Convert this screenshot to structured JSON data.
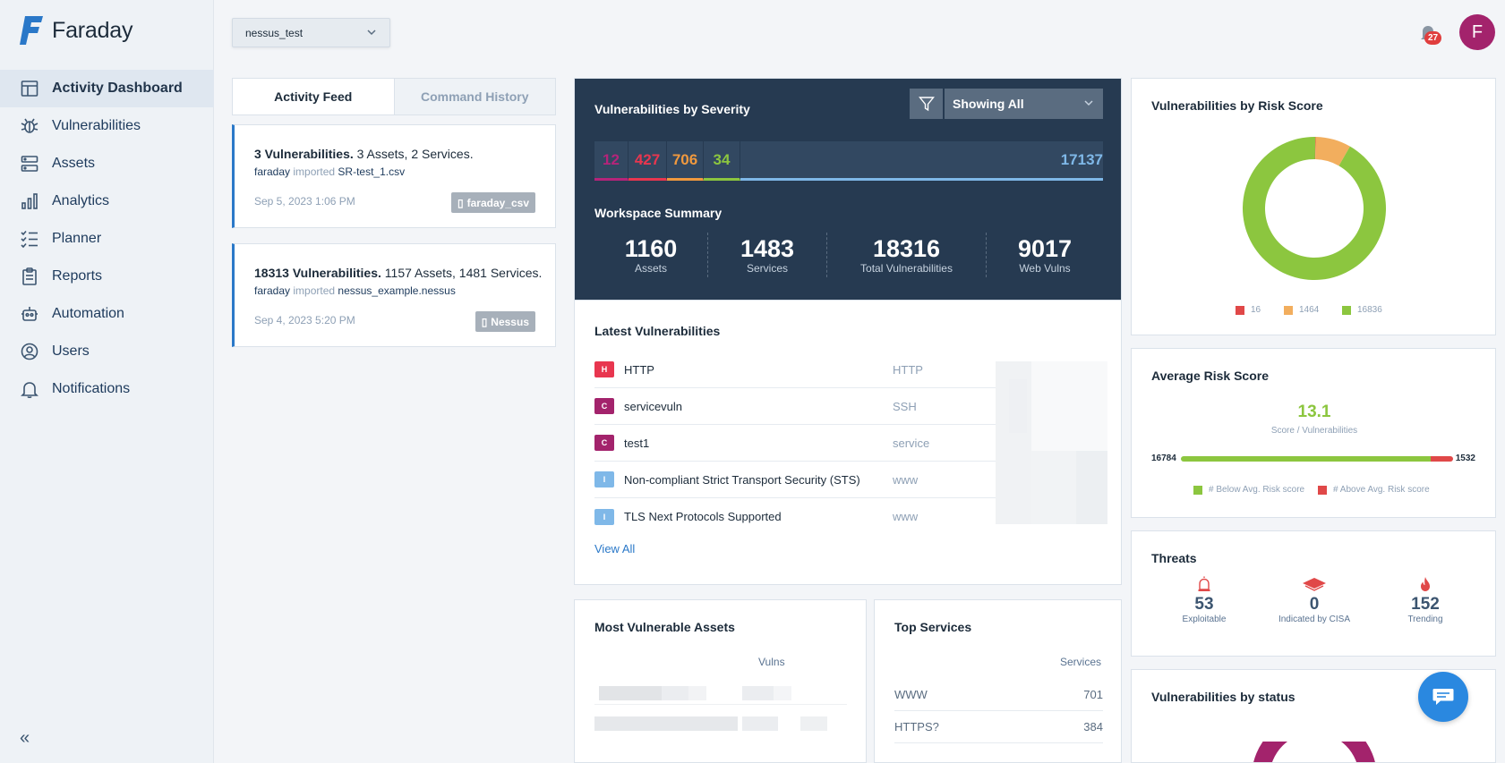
{
  "app": {
    "brand": "Faraday"
  },
  "sidebar": {
    "items": [
      {
        "label": "Activity Dashboard",
        "icon": "dashboard-icon",
        "active": true
      },
      {
        "label": "Vulnerabilities",
        "icon": "bug-icon"
      },
      {
        "label": "Assets",
        "icon": "server-icon"
      },
      {
        "label": "Analytics",
        "icon": "bar-chart-icon"
      },
      {
        "label": "Planner",
        "icon": "checklist-icon"
      },
      {
        "label": "Reports",
        "icon": "clipboard-icon"
      },
      {
        "label": "Automation",
        "icon": "robot-icon"
      },
      {
        "label": "Users",
        "icon": "user-icon"
      },
      {
        "label": "Notifications",
        "icon": "bell-icon"
      }
    ],
    "collapse_label": "«"
  },
  "header": {
    "workspace": "nessus_test",
    "notification_count": "27",
    "avatar_initial": "F"
  },
  "feed": {
    "tabs": [
      "Activity Feed",
      "Command History"
    ],
    "cards": [
      {
        "title_bold": "3 Vulnerabilities.",
        "title_rest": " 3 Assets, 2 Services.",
        "user": "faraday",
        "verb": "imported",
        "file": "SR-test_1.csv",
        "date": "Sep 5, 2023 1:06 PM",
        "tag": "faraday_csv"
      },
      {
        "title_bold": "18313 Vulnerabilities.",
        "title_rest": " 1157 Assets, 1481 Services.",
        "user": "faraday",
        "verb": "imported",
        "file": "nessus_example.nessus",
        "date": "Sep 4, 2023 5:20 PM",
        "tag": "Nessus"
      }
    ]
  },
  "severity": {
    "title": "Vulnerabilities by Severity",
    "filter_label": "Showing All",
    "segments": [
      {
        "value": "12",
        "color": "#b5247a"
      },
      {
        "value": "427",
        "color": "#e8364f"
      },
      {
        "value": "706",
        "color": "#f0993e"
      },
      {
        "value": "34",
        "color": "#8cc63f"
      },
      {
        "value": "17137",
        "color": "#7fb8e8"
      }
    ]
  },
  "workspace_summary": {
    "title": "Workspace Summary",
    "stats": [
      {
        "value": "1160",
        "label": "Assets"
      },
      {
        "value": "1483",
        "label": "Services"
      },
      {
        "value": "18316",
        "label": "Total Vulnerabilities"
      },
      {
        "value": "9017",
        "label": "Web Vulns"
      }
    ]
  },
  "latest": {
    "title": "Latest Vulnerabilities",
    "rows": [
      {
        "sev": "H",
        "color": "#e8364f",
        "name": "HTTP",
        "service": "HTTP"
      },
      {
        "sev": "C",
        "color": "#a3236c",
        "name": "servicevuln",
        "service": "SSH"
      },
      {
        "sev": "C",
        "color": "#a3236c",
        "name": "test1",
        "service": "service"
      },
      {
        "sev": "I",
        "color": "#7fb8e8",
        "name": "Non-compliant Strict Transport Security (STS)",
        "service": "www"
      },
      {
        "sev": "I",
        "color": "#7fb8e8",
        "name": "TLS Next Protocols Supported",
        "service": "www"
      }
    ],
    "view_all": "View All"
  },
  "most_vulnerable": {
    "title": "Most Vulnerable Assets",
    "col": "Vulns"
  },
  "top_services": {
    "title": "Top Services",
    "col": "Services",
    "rows": [
      {
        "name": "WWW",
        "count": "701"
      },
      {
        "name": "HTTPS?",
        "count": "384"
      }
    ]
  },
  "risk_score": {
    "title": "Vulnerabilities by Risk Score",
    "chart_data": {
      "type": "pie",
      "values": [
        16,
        1464,
        16836
      ],
      "labels": [
        "16",
        "1464",
        "16836"
      ],
      "colors": [
        "#e04848",
        "#f2ae5e",
        "#8cc63f"
      ]
    }
  },
  "avg_risk": {
    "title": "Average Risk Score",
    "value": "13.1",
    "subtitle": "Score / Vulnerabilities",
    "below": "16784",
    "above": "1532",
    "below_fraction": 0.9164,
    "legend_below": "# Below Avg. Risk score",
    "legend_above": "# Above Avg. Risk score",
    "below_color": "#8cc63f",
    "above_color": "#e04848"
  },
  "threats": {
    "title": "Threats",
    "items": [
      {
        "value": "53",
        "label": "Exploitable",
        "icon": "siren-icon"
      },
      {
        "value": "0",
        "label": "Indicated by CISA",
        "icon": "cisa-icon"
      },
      {
        "value": "152",
        "label": "Trending",
        "icon": "fire-icon"
      }
    ]
  },
  "status": {
    "title": "Vulnerabilities by status"
  }
}
